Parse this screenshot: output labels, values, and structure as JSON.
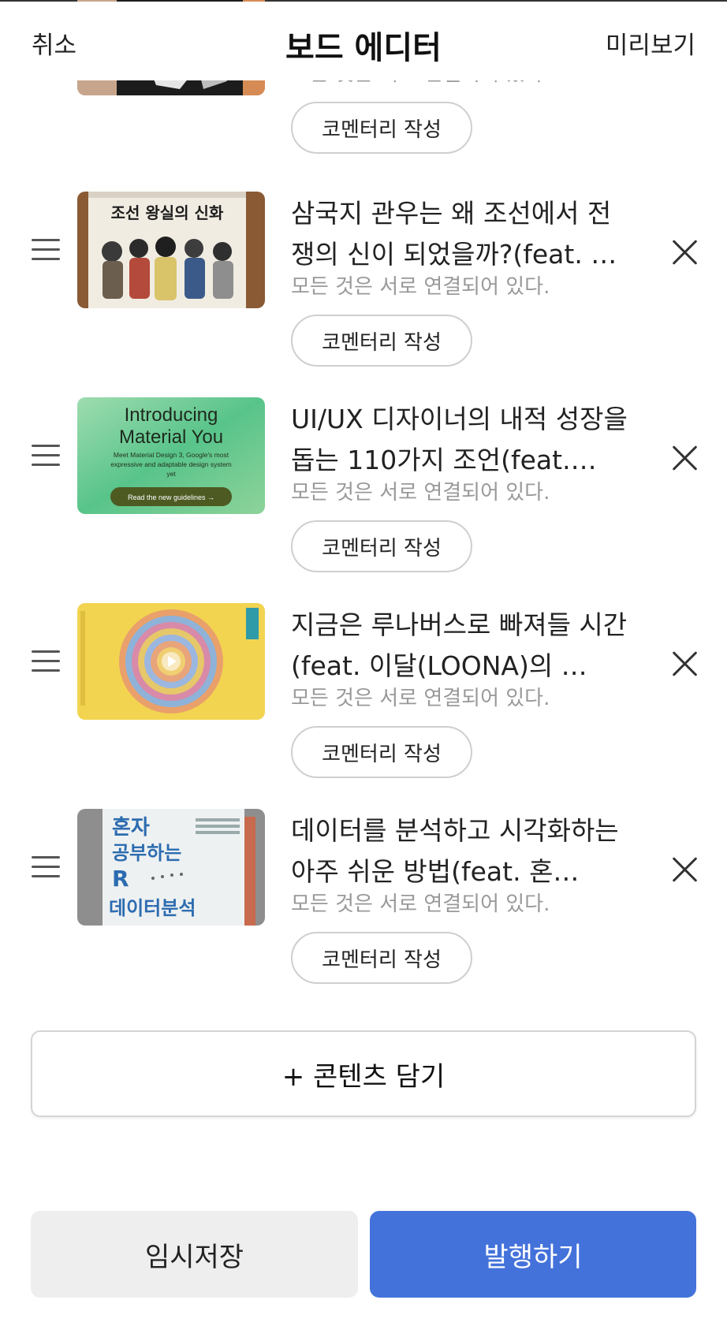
{
  "header": {
    "cancel_label": "취소",
    "title": "보드 에디터",
    "preview_label": "미리보기"
  },
  "items": [
    {
      "title": "",
      "subtitle": "모든 것은 서로 연결되어 있다.",
      "comment_label": "코멘터리 작성",
      "thumb_icon": "book-cover-dark"
    },
    {
      "title": "삼국지 관우는 왜 조선에서 전쟁의 신이 되었을까?(feat. …",
      "subtitle": "모든 것은 서로 연결되어 있다.",
      "comment_label": "코멘터리 작성",
      "thumb_icon": "book-cover-illustration",
      "thumb_text": "조선 왕실의 신화"
    },
    {
      "title": "UI/UX 디자이너의 내적 성장을 돕는 110가지 조언(feat.…",
      "subtitle": "모든 것은 서로 연결되어 있다.",
      "comment_label": "코멘터리 작성",
      "thumb_icon": "material-you-banner",
      "thumb_text": {
        "line1": "Introducing",
        "line2": "Material You",
        "desc1": "Meet Material Design 3, Google's most",
        "desc2": "expressive and adaptable design system",
        "desc3": "yet",
        "cta": "Read the new guidelines →"
      }
    },
    {
      "title": "지금은 루나버스로 빠져들 시간(feat. 이달(LOONA)의 …",
      "subtitle": "모든 것은 서로 연결되어 있다.",
      "comment_label": "코멘터리 작성",
      "thumb_icon": "video-play-thumbnail"
    },
    {
      "title": "데이터를 분석하고 시각화하는 아주 쉬운 방법(feat. 혼…",
      "subtitle": "모든 것은 서로 연결되어 있다.",
      "comment_label": "코멘터리 작성",
      "thumb_icon": "book-cover-r",
      "thumb_text": {
        "l1": "혼자",
        "l2": "공부하는",
        "l3": "R",
        "l4": "데이터분석"
      }
    }
  ],
  "add_button_label": "+ 콘텐츠 담기",
  "footer": {
    "draft_label": "임시저장",
    "publish_label": "발행하기"
  },
  "colors": {
    "accent": "#4472db",
    "muted_text": "#999999",
    "secondary_button": "#eeeeee"
  }
}
